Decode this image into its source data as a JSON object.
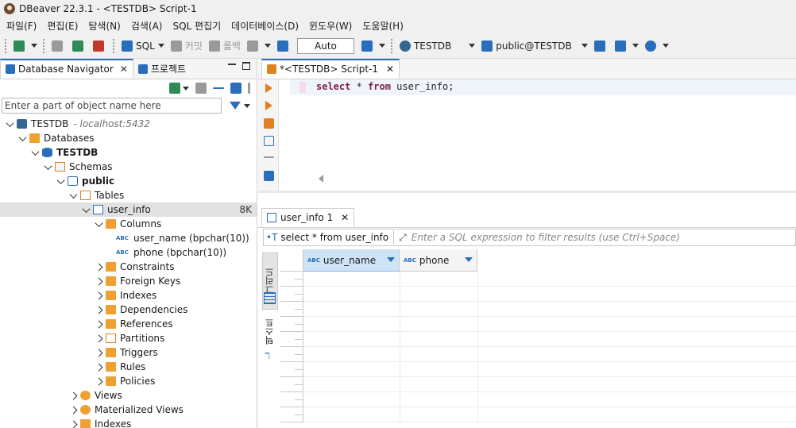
{
  "window": {
    "title": "DBeaver 22.3.1 - <TESTDB> Script-1"
  },
  "menu": [
    "파일(F)",
    "편집(E)",
    "탐색(N)",
    "검색(A)",
    "SQL 편집기",
    "데이터베이스(D)",
    "윈도우(W)",
    "도움말(H)"
  ],
  "toolbar": {
    "sql_label": "SQL",
    "commit_label": "커밋",
    "rollback_label": "롤백",
    "transaction_mode": "Auto",
    "datasource_label": "TESTDB",
    "schema_label": "public@TESTDB"
  },
  "navigator": {
    "tab_label": "Database Navigator",
    "projects_tab_label": "프로젝트",
    "filter_placeholder": "Enter a part of object name here",
    "tree": [
      {
        "label": "TESTDB",
        "hint": "- localhost:5432",
        "level": 0
      },
      {
        "label": "Databases",
        "level": 1
      },
      {
        "label": "TESTDB",
        "level": 2
      },
      {
        "label": "Schemas",
        "level": 3
      },
      {
        "label": "public",
        "level": 4
      },
      {
        "label": "Tables",
        "level": 5
      },
      {
        "label": "user_info",
        "size": "8K",
        "level": 6
      },
      {
        "label": "Columns",
        "level": 7
      },
      {
        "label": "user_name (bpchar(10))",
        "level": 8
      },
      {
        "label": "phone (bpchar(10))",
        "level": 8
      },
      {
        "label": "Constraints",
        "level": 7
      },
      {
        "label": "Foreign Keys",
        "level": 7
      },
      {
        "label": "Indexes",
        "level": 7
      },
      {
        "label": "Dependencies",
        "level": 7
      },
      {
        "label": "References",
        "level": 7
      },
      {
        "label": "Partitions",
        "level": 7
      },
      {
        "label": "Triggers",
        "level": 7
      },
      {
        "label": "Rules",
        "level": 7
      },
      {
        "label": "Policies",
        "level": 7
      },
      {
        "label": "Views",
        "level": 5
      },
      {
        "label": "Materialized Views",
        "level": 5
      },
      {
        "label": "Indexes",
        "level": 5
      }
    ]
  },
  "editor": {
    "tab_label": "*<TESTDB> Script-1",
    "kw_select": "select",
    "kw_from": "from",
    "code_rest_1": " * ",
    "code_rest_2": " user_info;"
  },
  "results": {
    "tab_label": "user_info 1",
    "query_text": "select * from user_info",
    "filter_placeholder": "Enter a SQL expression to filter results (use Ctrl+Space)",
    "side_tab_grid": "그리드",
    "side_tab_text": "텍스트",
    "columns": [
      "user_name",
      "phone"
    ]
  }
}
